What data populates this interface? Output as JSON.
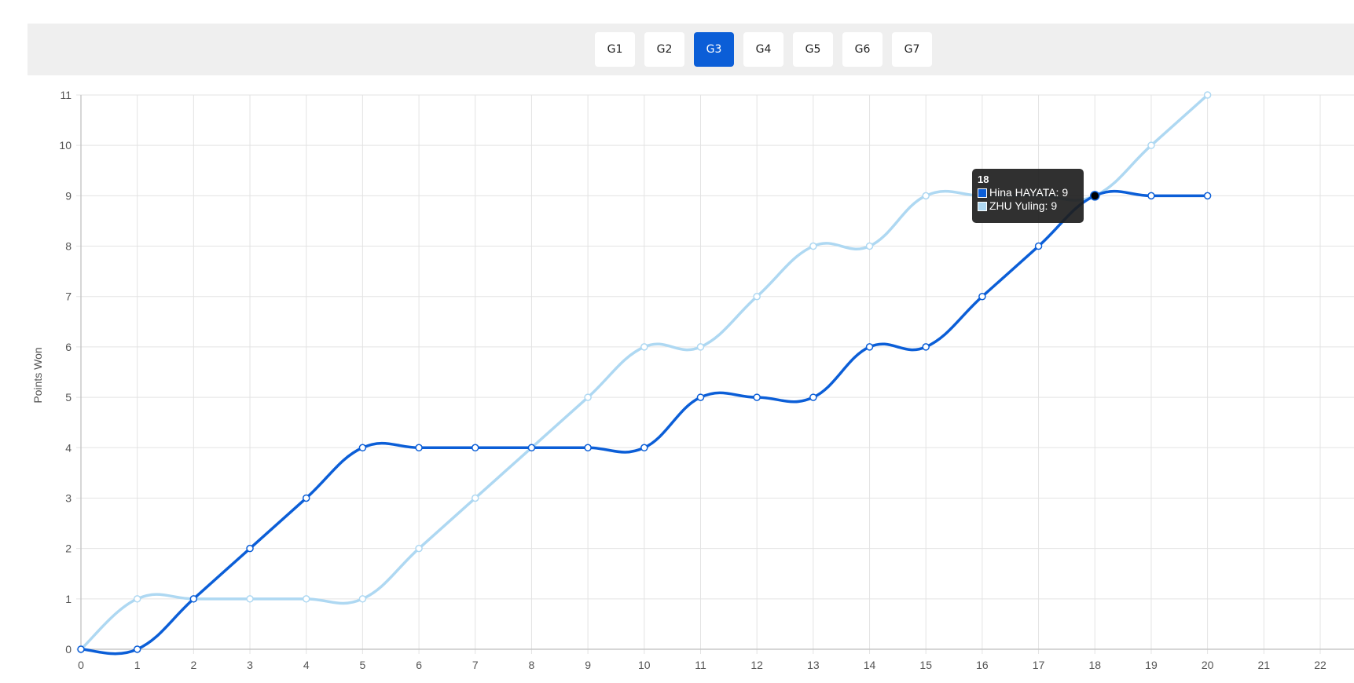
{
  "tabs": [
    {
      "label": "G1",
      "active": false
    },
    {
      "label": "G2",
      "active": false
    },
    {
      "label": "G3",
      "active": true
    },
    {
      "label": "G4",
      "active": false
    },
    {
      "label": "G5",
      "active": false
    },
    {
      "label": "G6",
      "active": false
    },
    {
      "label": "G7",
      "active": false
    }
  ],
  "chart_data": {
    "type": "line",
    "xlabel": "",
    "ylabel": "Points Won",
    "xlim": [
      0,
      22.6
    ],
    "ylim": [
      0,
      11
    ],
    "x_ticks": [
      0,
      1,
      2,
      3,
      4,
      5,
      6,
      7,
      8,
      9,
      10,
      11,
      12,
      13,
      14,
      15,
      16,
      17,
      18,
      19,
      20,
      21,
      22
    ],
    "y_ticks": [
      0,
      1,
      2,
      3,
      4,
      5,
      6,
      7,
      8,
      9,
      10,
      11
    ],
    "grid": true,
    "x": [
      0,
      1,
      2,
      3,
      4,
      5,
      6,
      7,
      8,
      9,
      10,
      11,
      12,
      13,
      14,
      15,
      16,
      17,
      18,
      19,
      20
    ],
    "series": [
      {
        "name": "Hina HAYATA",
        "color": "#0b5ed7",
        "values": [
          0,
          0,
          1,
          2,
          3,
          4,
          4,
          4,
          4,
          4,
          4,
          5,
          5,
          5,
          6,
          6,
          7,
          8,
          9,
          9,
          9
        ]
      },
      {
        "name": "ZHU Yuling",
        "color": "#aed8f2",
        "values": [
          0,
          1,
          1,
          1,
          1,
          1,
          2,
          3,
          4,
          5,
          6,
          6,
          7,
          8,
          8,
          9,
          9,
          9,
          9,
          10,
          11
        ]
      }
    ],
    "tooltip": {
      "title": "18",
      "x": 18,
      "rows": [
        {
          "label": "Hina HAYATA: 9",
          "color": "#0b5ed7"
        },
        {
          "label": "ZHU Yuling: 9",
          "color": "#aed8f2"
        }
      ]
    }
  }
}
